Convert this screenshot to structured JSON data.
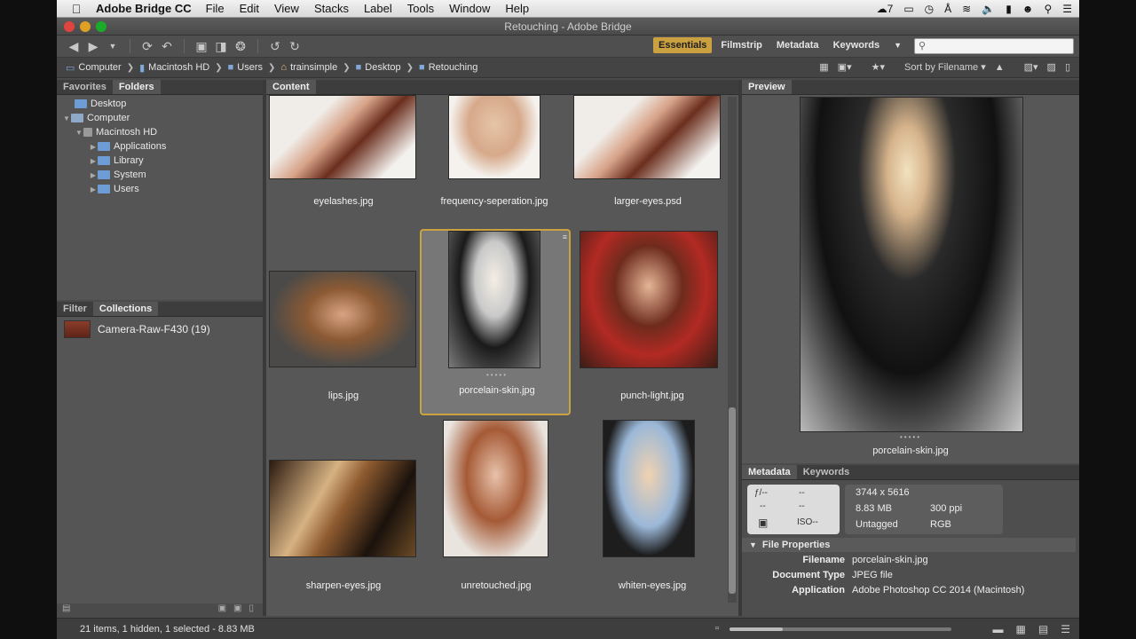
{
  "menubar": {
    "app_name": "Adobe Bridge CC",
    "items": [
      "File",
      "Edit",
      "View",
      "Stacks",
      "Label",
      "Tools",
      "Window",
      "Help"
    ],
    "status_count": "7"
  },
  "window": {
    "title": "Retouching - Adobe Bridge"
  },
  "workspaces": {
    "items": [
      "Essentials",
      "Filmstrip",
      "Metadata",
      "Keywords"
    ],
    "active": "Essentials"
  },
  "search": {
    "placeholder": ""
  },
  "path": {
    "crumbs": [
      "Computer",
      "Macintosh HD",
      "Users",
      "trainsimple",
      "Desktop",
      "Retouching"
    ],
    "sort_label": "Sort by Filename"
  },
  "left_panel": {
    "tabs": [
      "Favorites",
      "Folders"
    ],
    "active_tab": "Folders",
    "tree": [
      "Desktop",
      "Computer",
      "Macintosh HD",
      "Applications",
      "Library",
      "System",
      "Users"
    ]
  },
  "collections_panel": {
    "tabs": [
      "Filter",
      "Collections"
    ],
    "active_tab": "Collections",
    "items": [
      {
        "label": "Camera-Raw-F430 (19)"
      }
    ]
  },
  "content": {
    "tab": "Content",
    "items": [
      "eyelashes.jpg",
      "frequency-seperation.jpg",
      "larger-eyes.psd",
      "lips.jpg",
      "porcelain-skin.jpg",
      "punch-light.jpg",
      "sharpen-eyes.jpg",
      "unretouched.jpg",
      "whiten-eyes.jpg"
    ],
    "selected": "porcelain-skin.jpg"
  },
  "preview": {
    "tab": "Preview",
    "caption": "porcelain-skin.jpg"
  },
  "metadata": {
    "tabs": [
      "Metadata",
      "Keywords"
    ],
    "camera": {
      "aperture": "ƒ/--",
      "shutter": "--",
      "ev": "--",
      "wb": "--",
      "iso": "ISO--"
    },
    "info": {
      "dimensions": "3744 x 5616",
      "size": "8.83 MB",
      "resolution": "300 ppi",
      "tagged": "Untagged",
      "mode": "RGB"
    },
    "section_title": "File Properties",
    "properties": [
      {
        "key": "Filename",
        "value": "porcelain-skin.jpg"
      },
      {
        "key": "Document Type",
        "value": "JPEG file"
      },
      {
        "key": "Application",
        "value": "Adobe Photoshop CC 2014 (Macintosh)"
      }
    ]
  },
  "status": {
    "text": "21 items, 1 hidden, 1 selected - 8.83 MB",
    "thumbnail_size": 0.24
  }
}
